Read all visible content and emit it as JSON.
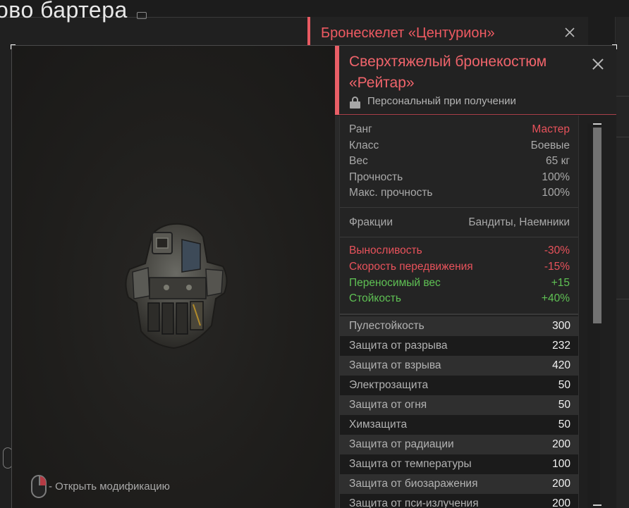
{
  "background": {
    "title": "ово бартера",
    "card_title": "Бронескелет «Центурион»"
  },
  "viewer": {
    "hint_text": "- Открыть модификацию"
  },
  "item": {
    "title": "Сверхтяжелый бронекостюм «Рейтар»",
    "binding": "Персональный при получении",
    "info": [
      {
        "label": "Ранг",
        "value": "Мастер",
        "value_color": "#e8525b"
      },
      {
        "label": "Класс",
        "value": "Боевые"
      },
      {
        "label": "Вес",
        "value": "65 кг"
      },
      {
        "label": "Прочность",
        "value": "100%"
      },
      {
        "label": "Макс. прочность",
        "value": "100%"
      }
    ],
    "factions": {
      "label": "Фракции",
      "value": "Бандиты, Наемники"
    },
    "modifiers": [
      {
        "label": "Выносливость",
        "value": "-30%",
        "type": "negative"
      },
      {
        "label": "Скорость передвижения",
        "value": "-15%",
        "type": "negative"
      },
      {
        "label": "Переносимый вес",
        "value": "+15",
        "type": "positive"
      },
      {
        "label": "Стойкость",
        "value": "+40%",
        "type": "positive"
      }
    ],
    "resistances": [
      {
        "label": "Пулестойкость",
        "value": "300"
      },
      {
        "label": "Защита от разрыва",
        "value": "232"
      },
      {
        "label": "Защита от взрыва",
        "value": "420"
      },
      {
        "label": "Электрозащита",
        "value": "50"
      },
      {
        "label": "Защита от огня",
        "value": "50"
      },
      {
        "label": "Химзащита",
        "value": "50"
      },
      {
        "label": "Защита от радиации",
        "value": "200"
      },
      {
        "label": "Защита от температуры",
        "value": "100"
      },
      {
        "label": "Защита от биозаражения",
        "value": "200"
      },
      {
        "label": "Защита от пси-излучения",
        "value": "200"
      }
    ]
  },
  "colors": {
    "accent": "#e95f67",
    "negative": "#e8525b",
    "positive": "#5fc154"
  }
}
